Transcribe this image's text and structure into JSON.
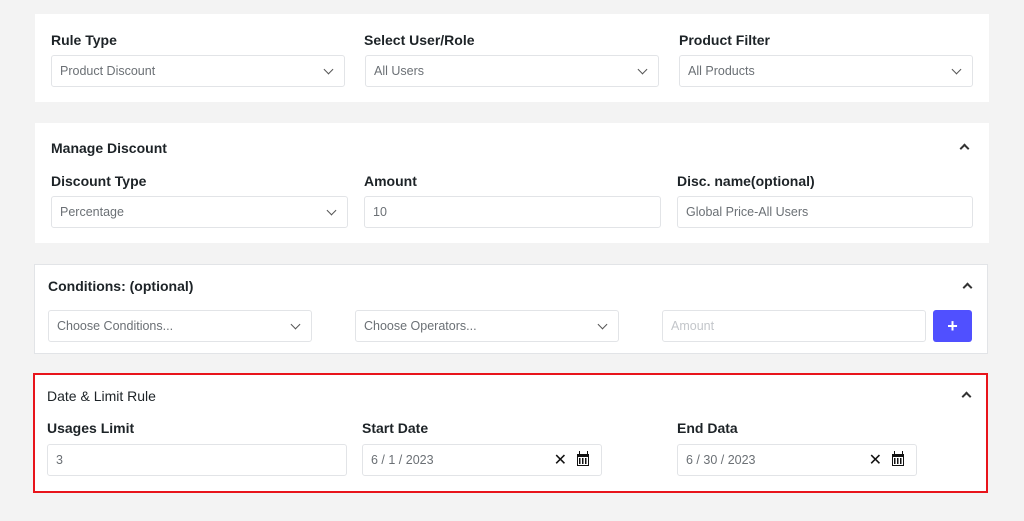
{
  "rule_section": {
    "rule_type": {
      "label": "Rule Type",
      "value": "Product Discount"
    },
    "user_role": {
      "label": "Select User/Role",
      "value": "All Users"
    },
    "product_filter": {
      "label": "Product Filter",
      "value": "All Products"
    }
  },
  "manage_discount": {
    "title": "Manage Discount",
    "discount_type": {
      "label": "Discount Type",
      "value": "Percentage"
    },
    "amount": {
      "label": "Amount",
      "value": "10"
    },
    "disc_name": {
      "label": "Disc. name(optional)",
      "value": "Global Price-All Users"
    }
  },
  "conditions": {
    "title": "Conditions: (optional)",
    "condition_select": {
      "value": "Choose Conditions..."
    },
    "operator_select": {
      "value": "Choose Operators..."
    },
    "amount_input": {
      "placeholder": "Amount"
    },
    "add_button": {
      "label": "+"
    }
  },
  "date_limit": {
    "title": "Date & Limit Rule",
    "usage_limit": {
      "label": "Usages Limit",
      "value": "3"
    },
    "start_date": {
      "label": "Start Date",
      "value": "6 / 1 / 2023",
      "clear": "✕"
    },
    "end_date": {
      "label": "End Data",
      "value": "6 / 30 / 2023",
      "clear": "✕"
    }
  },
  "colors": {
    "accent": "#5050ff",
    "highlight_border": "#e8141b"
  }
}
